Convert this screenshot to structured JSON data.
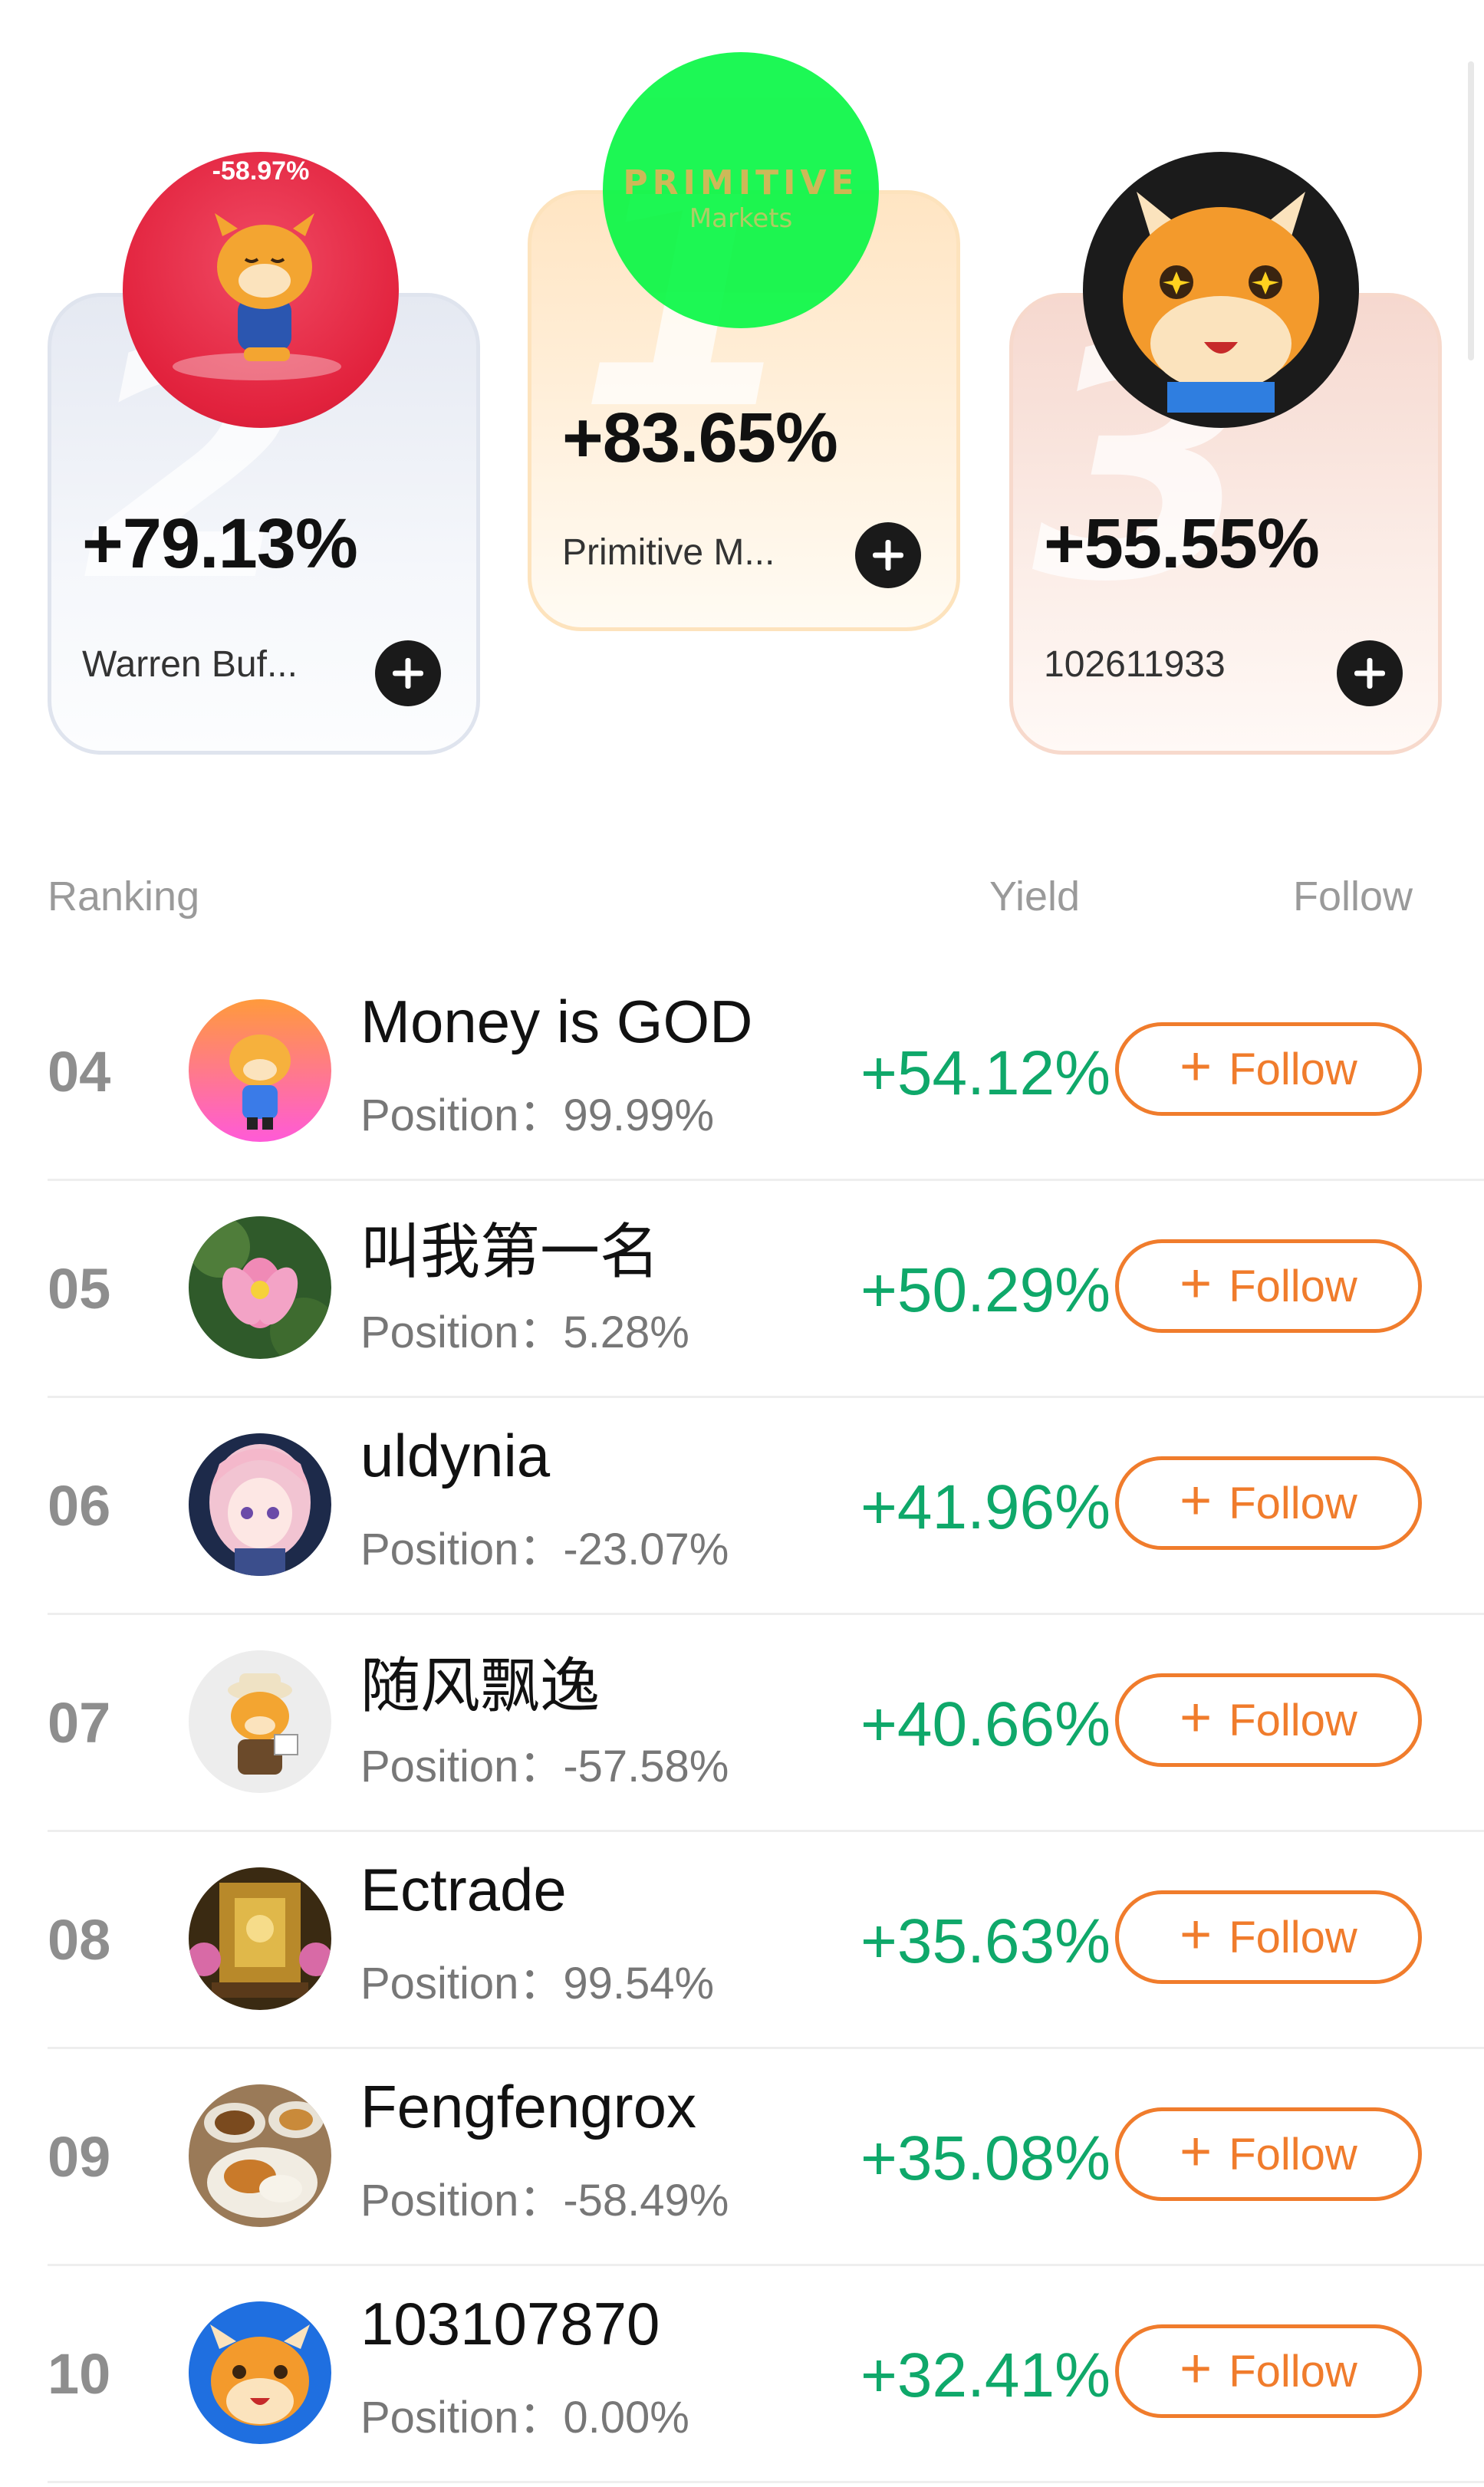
{
  "podium": [
    {
      "rank": "2",
      "yield": "+79.13%",
      "name": "Warren Buf...",
      "avatar_badge": "-58.97%"
    },
    {
      "rank": "1",
      "yield": "+83.65%",
      "name": "Primitive M...",
      "logo_text": "PRIMITIVE",
      "logo_sub": "Markets"
    },
    {
      "rank": "3",
      "yield": "+55.55%",
      "name": "102611933"
    }
  ],
  "table_header": {
    "ranking": "Ranking",
    "yield": "Yield",
    "follow": "Follow"
  },
  "rows": [
    {
      "rank": "04",
      "name": "Money is GOD",
      "position": "Position：99.99%",
      "yield": "+54.12%",
      "follow_label": "Follow"
    },
    {
      "rank": "05",
      "name": "叫我第一名",
      "position": "Position：5.28%",
      "yield": "+50.29%",
      "follow_label": "Follow"
    },
    {
      "rank": "06",
      "name": "uldynia",
      "position": "Position：-23.07%",
      "yield": "+41.96%",
      "follow_label": "Follow"
    },
    {
      "rank": "07",
      "name": "随风飘逸",
      "position": "Position：-57.58%",
      "yield": "+40.66%",
      "follow_label": "Follow"
    },
    {
      "rank": "08",
      "name": "Ectrade",
      "position": "Position：99.54%",
      "yield": "+35.63%",
      "follow_label": "Follow"
    },
    {
      "rank": "09",
      "name": "Fengfengrox",
      "position": "Position：-58.49%",
      "yield": "+35.08%",
      "follow_label": "Follow"
    },
    {
      "rank": "10",
      "name": "103107870",
      "position": "Position：0.00%",
      "yield": "+32.41%",
      "follow_label": "Follow"
    }
  ],
  "colors": {
    "yield_green": "#0fa86a",
    "follow_orange": "#f07c2c",
    "rank_gray": "#8e8e8e"
  }
}
